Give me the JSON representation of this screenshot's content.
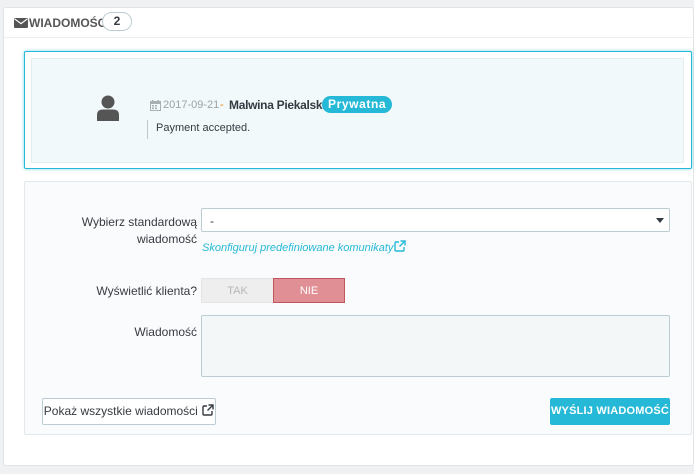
{
  "panel": {
    "title": "WIADOMOŚCI",
    "count": "2",
    "icon": "envelope-icon"
  },
  "message": {
    "date": "2017-09-21",
    "separator": "-",
    "author": "Malwina Piekalski",
    "badge": "Prywatna",
    "text": "Payment accepted.",
    "avatar_icon": "user-icon",
    "date_icon": "calendar-icon"
  },
  "form": {
    "template_label": "Wybierz standardową wiadomość",
    "template_value": "-",
    "config_link": "Skonfiguruj predefiniowane komunikaty",
    "display_label": "Wyświetlić klienta?",
    "toggle_yes": "TAK",
    "toggle_no": "NIE",
    "toggle_selected": "NIE",
    "message_label": "Wiadomość",
    "message_value": ""
  },
  "buttons": {
    "show_all": "Pokaż wszystkie wiadomości",
    "send": "WYŚLIJ WIADOMOŚĆ"
  },
  "colors": {
    "accent": "#25b9d7",
    "toggle_no_bg": "#e08f95",
    "date_separator": "#ef7d00"
  }
}
